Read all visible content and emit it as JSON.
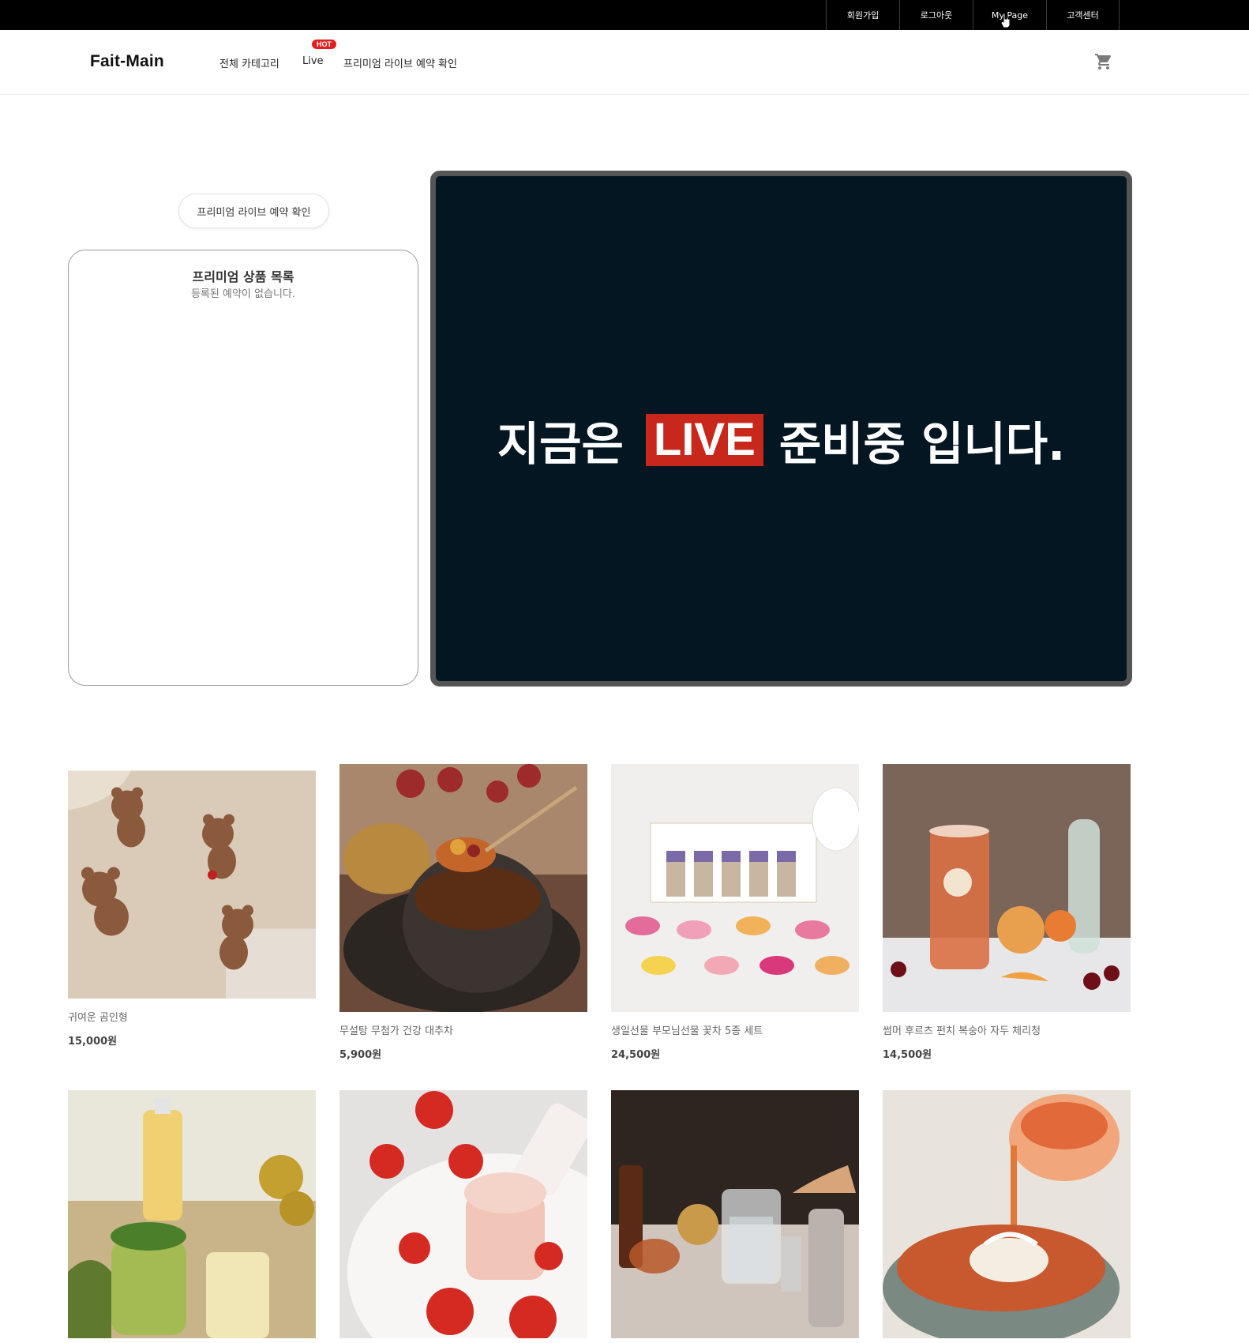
{
  "topbar": {
    "links": [
      "회원가입",
      "로그아웃",
      "My Page",
      "고객센터"
    ]
  },
  "header": {
    "logo": "Fait-Main",
    "nav": {
      "all_categories": "전체 카테고리",
      "live": "Live",
      "live_badge": "HOT",
      "premium_reservation": "프리미엄 라이브 예약 확인"
    },
    "cart_icon": "shopping-cart-icon"
  },
  "reservation_button": "프리미엄 라이브 예약 확인",
  "premium_panel": {
    "title": "프리미엄 상품 목록",
    "empty_message": "등록된 예약이 없습니다."
  },
  "live_screen": {
    "text_before": "지금은",
    "badge": "LIVE",
    "text_after": "준비중 입니다."
  },
  "products": [
    {
      "name": "귀여운 곰인형",
      "price": "15,000원",
      "image": "teddy-bear-figurines"
    },
    {
      "name": "무설탕 무첨가 건강 대추차",
      "price": "5,900원",
      "image": "jujube-tea-bowl"
    },
    {
      "name": "생일선물 부모님선물 꽃차 5종 세트",
      "price": "24,500원",
      "image": "flower-tea-gift-set"
    },
    {
      "name": "썸머 후르츠 펀치 복숭아 자두 체리청",
      "price": "14,500원",
      "image": "fruit-punch-drink"
    },
    {
      "name": "",
      "price": "",
      "image": "citrus-mojito-drinks"
    },
    {
      "name": "",
      "price": "",
      "image": "plum-ade-drink"
    },
    {
      "name": "",
      "price": "",
      "image": "tea-pitcher-set"
    },
    {
      "name": "",
      "price": "",
      "image": "cold-noodle-broth"
    }
  ],
  "colors": {
    "topbar": "#000000",
    "live_bg": "#031622",
    "live_badge": "#c8281c",
    "hot_badge": "#e02020"
  }
}
